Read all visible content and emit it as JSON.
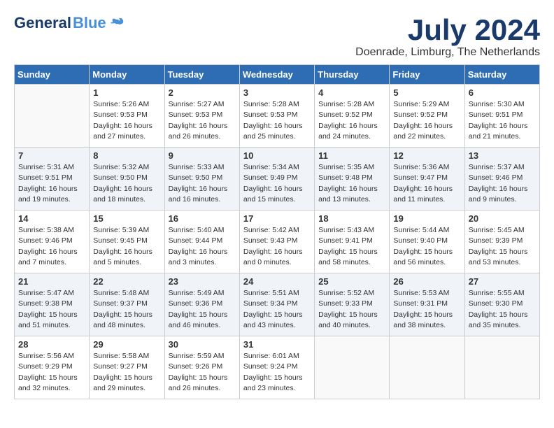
{
  "header": {
    "logo_general": "General",
    "logo_blue": "Blue",
    "month_year": "July 2024",
    "location": "Doenrade, Limburg, The Netherlands"
  },
  "weekdays": [
    "Sunday",
    "Monday",
    "Tuesday",
    "Wednesday",
    "Thursday",
    "Friday",
    "Saturday"
  ],
  "weeks": [
    [
      {
        "day": "",
        "info": ""
      },
      {
        "day": "1",
        "info": "Sunrise: 5:26 AM\nSunset: 9:53 PM\nDaylight: 16 hours\nand 27 minutes."
      },
      {
        "day": "2",
        "info": "Sunrise: 5:27 AM\nSunset: 9:53 PM\nDaylight: 16 hours\nand 26 minutes."
      },
      {
        "day": "3",
        "info": "Sunrise: 5:28 AM\nSunset: 9:53 PM\nDaylight: 16 hours\nand 25 minutes."
      },
      {
        "day": "4",
        "info": "Sunrise: 5:28 AM\nSunset: 9:52 PM\nDaylight: 16 hours\nand 24 minutes."
      },
      {
        "day": "5",
        "info": "Sunrise: 5:29 AM\nSunset: 9:52 PM\nDaylight: 16 hours\nand 22 minutes."
      },
      {
        "day": "6",
        "info": "Sunrise: 5:30 AM\nSunset: 9:51 PM\nDaylight: 16 hours\nand 21 minutes."
      }
    ],
    [
      {
        "day": "7",
        "info": "Sunrise: 5:31 AM\nSunset: 9:51 PM\nDaylight: 16 hours\nand 19 minutes."
      },
      {
        "day": "8",
        "info": "Sunrise: 5:32 AM\nSunset: 9:50 PM\nDaylight: 16 hours\nand 18 minutes."
      },
      {
        "day": "9",
        "info": "Sunrise: 5:33 AM\nSunset: 9:50 PM\nDaylight: 16 hours\nand 16 minutes."
      },
      {
        "day": "10",
        "info": "Sunrise: 5:34 AM\nSunset: 9:49 PM\nDaylight: 16 hours\nand 15 minutes."
      },
      {
        "day": "11",
        "info": "Sunrise: 5:35 AM\nSunset: 9:48 PM\nDaylight: 16 hours\nand 13 minutes."
      },
      {
        "day": "12",
        "info": "Sunrise: 5:36 AM\nSunset: 9:47 PM\nDaylight: 16 hours\nand 11 minutes."
      },
      {
        "day": "13",
        "info": "Sunrise: 5:37 AM\nSunset: 9:46 PM\nDaylight: 16 hours\nand 9 minutes."
      }
    ],
    [
      {
        "day": "14",
        "info": "Sunrise: 5:38 AM\nSunset: 9:46 PM\nDaylight: 16 hours\nand 7 minutes."
      },
      {
        "day": "15",
        "info": "Sunrise: 5:39 AM\nSunset: 9:45 PM\nDaylight: 16 hours\nand 5 minutes."
      },
      {
        "day": "16",
        "info": "Sunrise: 5:40 AM\nSunset: 9:44 PM\nDaylight: 16 hours\nand 3 minutes."
      },
      {
        "day": "17",
        "info": "Sunrise: 5:42 AM\nSunset: 9:43 PM\nDaylight: 16 hours\nand 0 minutes."
      },
      {
        "day": "18",
        "info": "Sunrise: 5:43 AM\nSunset: 9:41 PM\nDaylight: 15 hours\nand 58 minutes."
      },
      {
        "day": "19",
        "info": "Sunrise: 5:44 AM\nSunset: 9:40 PM\nDaylight: 15 hours\nand 56 minutes."
      },
      {
        "day": "20",
        "info": "Sunrise: 5:45 AM\nSunset: 9:39 PM\nDaylight: 15 hours\nand 53 minutes."
      }
    ],
    [
      {
        "day": "21",
        "info": "Sunrise: 5:47 AM\nSunset: 9:38 PM\nDaylight: 15 hours\nand 51 minutes."
      },
      {
        "day": "22",
        "info": "Sunrise: 5:48 AM\nSunset: 9:37 PM\nDaylight: 15 hours\nand 48 minutes."
      },
      {
        "day": "23",
        "info": "Sunrise: 5:49 AM\nSunset: 9:36 PM\nDaylight: 15 hours\nand 46 minutes."
      },
      {
        "day": "24",
        "info": "Sunrise: 5:51 AM\nSunset: 9:34 PM\nDaylight: 15 hours\nand 43 minutes."
      },
      {
        "day": "25",
        "info": "Sunrise: 5:52 AM\nSunset: 9:33 PM\nDaylight: 15 hours\nand 40 minutes."
      },
      {
        "day": "26",
        "info": "Sunrise: 5:53 AM\nSunset: 9:31 PM\nDaylight: 15 hours\nand 38 minutes."
      },
      {
        "day": "27",
        "info": "Sunrise: 5:55 AM\nSunset: 9:30 PM\nDaylight: 15 hours\nand 35 minutes."
      }
    ],
    [
      {
        "day": "28",
        "info": "Sunrise: 5:56 AM\nSunset: 9:29 PM\nDaylight: 15 hours\nand 32 minutes."
      },
      {
        "day": "29",
        "info": "Sunrise: 5:58 AM\nSunset: 9:27 PM\nDaylight: 15 hours\nand 29 minutes."
      },
      {
        "day": "30",
        "info": "Sunrise: 5:59 AM\nSunset: 9:26 PM\nDaylight: 15 hours\nand 26 minutes."
      },
      {
        "day": "31",
        "info": "Sunrise: 6:01 AM\nSunset: 9:24 PM\nDaylight: 15 hours\nand 23 minutes."
      },
      {
        "day": "",
        "info": ""
      },
      {
        "day": "",
        "info": ""
      },
      {
        "day": "",
        "info": ""
      }
    ]
  ]
}
